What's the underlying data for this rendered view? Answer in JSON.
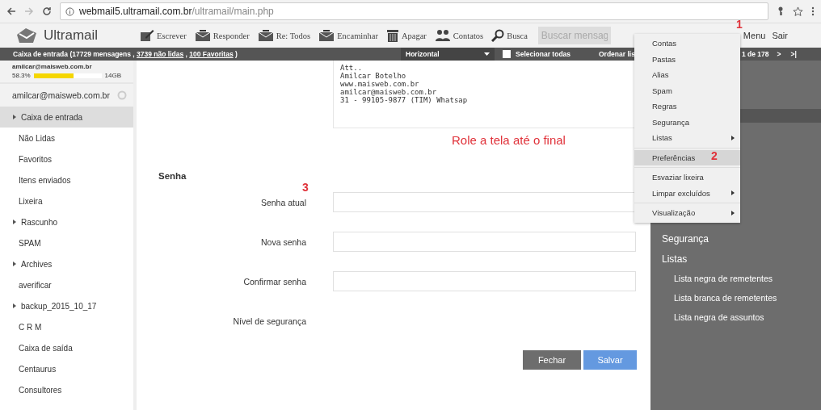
{
  "browser": {
    "url_host": "webmail5.ultramail.com.br",
    "url_path": "/ultramail/main.php"
  },
  "app": {
    "logo": "Ultramail"
  },
  "toolbar": [
    {
      "label": "Escrever",
      "kind": "compose"
    },
    {
      "label": "Responder",
      "kind": "reply"
    },
    {
      "label": "Re: Todos",
      "kind": "replyall"
    },
    {
      "label": "Encaminhar",
      "kind": "forward"
    },
    {
      "label": "Apagar",
      "kind": "delete"
    },
    {
      "label": "Contatos",
      "kind": "contacts"
    },
    {
      "label": "Busca",
      "kind": "search"
    }
  ],
  "search": {
    "placeholder": "Buscar mensag"
  },
  "top_links": [
    "Menu",
    "Sair"
  ],
  "status_bar": {
    "prefix": "Caixa de entrada (17729 mensagens , ",
    "unread": "3739 não lidas",
    "sep": " , ",
    "favorites": "100 Favoritas",
    "suffix": " )",
    "view": "Horizontal",
    "select_all": {
      "label": "Selecionar todas",
      "checked": false
    },
    "sort": "Ordenar lis",
    "page": "1 de 178",
    "next": ">",
    "last": ">|"
  },
  "quota": {
    "email": "amilcar@maisweb.com.br",
    "percent": "58.3%",
    "level": 0.583,
    "total": "14GB"
  },
  "account": "amilcar@maisweb.com.br",
  "folders": [
    {
      "label": "Caixa de entrada",
      "expandable": true,
      "selected": true
    },
    {
      "label": "Não Lidas",
      "expandable": false,
      "selected": false
    },
    {
      "label": "Favoritos",
      "expandable": false,
      "selected": false
    },
    {
      "label": "Itens enviados",
      "expandable": false,
      "selected": false
    },
    {
      "label": "Lixeira",
      "expandable": false,
      "selected": false
    },
    {
      "label": "Rascunho",
      "expandable": true,
      "selected": false
    },
    {
      "label": "SPAM",
      "expandable": false,
      "selected": false
    },
    {
      "label": "Archives",
      "expandable": true,
      "selected": false
    },
    {
      "label": "averificar",
      "expandable": false,
      "selected": false
    },
    {
      "label": "backup_2015_10_17",
      "expandable": true,
      "selected": false
    },
    {
      "label": "C R M",
      "expandable": false,
      "selected": false
    },
    {
      "label": "Caixa de saída",
      "expandable": false,
      "selected": false
    },
    {
      "label": "Centaurus",
      "expandable": false,
      "selected": false
    },
    {
      "label": "Consultores",
      "expandable": false,
      "selected": false
    }
  ],
  "signature": [
    "Att..",
    "Amilcar Botelho",
    "www.maisweb.com.br",
    "amilcar@maisweb.com.br",
    "31 - 99105-9877 (TIM) Whatsap"
  ],
  "password_form": {
    "title": "Senha",
    "fields": [
      {
        "label": "Senha atual",
        "kind": "input"
      },
      {
        "label": "Nova senha",
        "kind": "input"
      },
      {
        "label": "Confirmar senha",
        "kind": "input"
      },
      {
        "label": "Nível de segurança",
        "kind": "meter"
      }
    ],
    "buttons": [
      {
        "label": "Fechar",
        "kind": "secondary"
      },
      {
        "label": "Salvar",
        "kind": "primary"
      }
    ]
  },
  "right_panel": [
    {
      "label": "Segurança"
    },
    {
      "label": "Listas",
      "children": [
        {
          "label": "Lista negra de remetentes"
        },
        {
          "label": "Lista branca de remetentes"
        },
        {
          "label": "Lista negra de assuntos"
        }
      ]
    }
  ],
  "menu": [
    {
      "label": "Contas",
      "submenu": false,
      "selected": false,
      "divider_before": false
    },
    {
      "label": "Pastas",
      "submenu": false,
      "selected": false,
      "divider_before": false
    },
    {
      "label": "Alias",
      "submenu": false,
      "selected": false,
      "divider_before": false
    },
    {
      "label": "Spam",
      "submenu": false,
      "selected": false,
      "divider_before": false
    },
    {
      "label": "Regras",
      "submenu": false,
      "selected": false,
      "divider_before": false
    },
    {
      "label": "Segurança",
      "submenu": false,
      "selected": false,
      "divider_before": false
    },
    {
      "label": "Listas",
      "submenu": true,
      "selected": false,
      "divider_before": false
    },
    {
      "label": "Preferências",
      "submenu": false,
      "selected": true,
      "divider_before": true
    },
    {
      "label": "Esvaziar lixeira",
      "submenu": false,
      "selected": false,
      "divider_before": true
    },
    {
      "label": "Limpar excluídos",
      "submenu": true,
      "selected": false,
      "divider_before": false
    },
    {
      "label": "Visualização",
      "submenu": true,
      "selected": false,
      "divider_before": true
    }
  ],
  "annotations": {
    "step_1": "1",
    "step_2": "2",
    "step_3": "3",
    "hint": "Role a tela até o final"
  }
}
